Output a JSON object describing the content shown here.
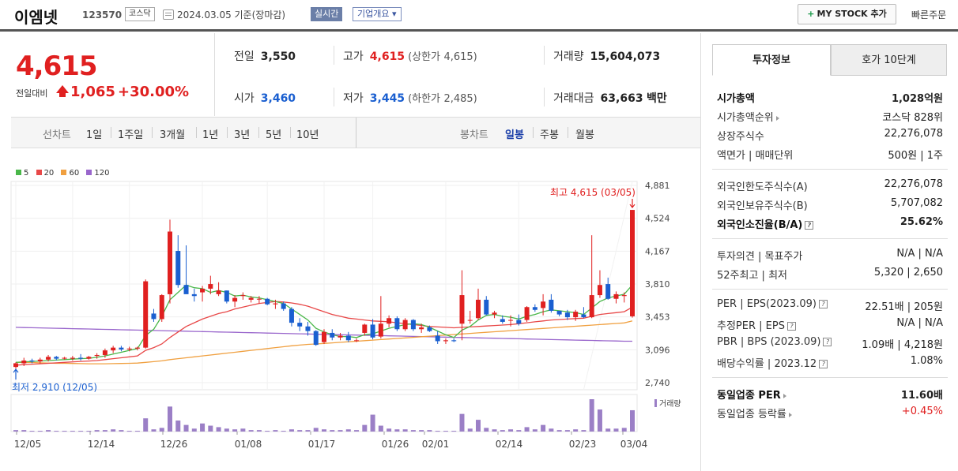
{
  "header": {
    "company": "이엠넷",
    "code": "123570",
    "market": "코스닥",
    "basis": "2024.03.05  기준(장마감)",
    "realtime": "실시간",
    "overview": "기업개요 ▾",
    "mystock": "MY STOCK 추가",
    "quick_order": "빠른주문"
  },
  "price": {
    "current": "4,615",
    "change_label": "전일대비",
    "change": "1,065",
    "change_pct": "+30.00%"
  },
  "stats": {
    "prev_label": "전일",
    "prev": "3,550",
    "high_label": "고가",
    "high": "4,615",
    "upper_label": "(상한가",
    "upper": "4,615)",
    "volume_label": "거래량",
    "volume": "15,604,073",
    "open_label": "시가",
    "open": "3,460",
    "low_label": "저가",
    "low": "3,445",
    "lower_label": "(하한가",
    "lower": "2,485)",
    "amount_label": "거래대금",
    "amount": "63,663",
    "amount_unit": "백만"
  },
  "tabs": {
    "line_label": "선차트",
    "line": [
      "1일",
      "1주일",
      "3개월",
      "1년",
      "3년",
      "5년",
      "10년"
    ],
    "candle_label": "봉차트",
    "candle": [
      "일봉",
      "주봉",
      "월봉"
    ]
  },
  "colors": {
    "up": "#e02020",
    "down": "#1a5fd0",
    "ma5": "#49b749",
    "ma20": "#e84848",
    "ma60": "#f0a040",
    "ma120": "#9966cc",
    "volume": "#9b7fc6"
  },
  "chart_data": {
    "type": "candlestick",
    "legend": [
      "5",
      "20",
      "60",
      "120"
    ],
    "ylim": [
      2740,
      4881
    ],
    "yticks": [
      "4,881",
      "4,524",
      "4,167",
      "3,810",
      "3,453",
      "3,096",
      "2,740"
    ],
    "xticks": [
      "12/05",
      "12/14",
      "12/26",
      "01/08",
      "01/17",
      "01/26",
      "02/01",
      "02/14",
      "02/23",
      "03/04"
    ],
    "high_annotation": "최고 4,615 (03/05)",
    "low_annotation": "최저 2,910 (12/05)",
    "volume_label": "거래량",
    "candles": [
      [
        2910,
        2960,
        2890,
        2950
      ],
      [
        2950,
        3010,
        2920,
        2980
      ],
      [
        2980,
        3000,
        2950,
        2970
      ],
      [
        2970,
        3010,
        2950,
        2990
      ],
      [
        2990,
        3040,
        2970,
        3020
      ],
      [
        3020,
        3030,
        2980,
        3000
      ],
      [
        3000,
        3020,
        2990,
        3010
      ],
      [
        3000,
        3030,
        2980,
        3010
      ],
      [
        3010,
        3050,
        2980,
        3000
      ],
      [
        3000,
        3030,
        2990,
        3020
      ],
      [
        3030,
        3060,
        3000,
        3040
      ],
      [
        3040,
        3110,
        3010,
        3090
      ],
      [
        3090,
        3140,
        3060,
        3120
      ],
      [
        3120,
        3140,
        3080,
        3100
      ],
      [
        3100,
        3130,
        3080,
        3110
      ],
      [
        3110,
        3130,
        3090,
        3120
      ],
      [
        3120,
        3860,
        3110,
        3840
      ],
      [
        3490,
        3540,
        3400,
        3430
      ],
      [
        3430,
        3700,
        3400,
        3690
      ],
      [
        3700,
        4510,
        3600,
        4380
      ],
      [
        4170,
        4340,
        3770,
        3800
      ],
      [
        3800,
        4230,
        3760,
        3700
      ],
      [
        3700,
        3760,
        3620,
        3680
      ],
      [
        3720,
        3790,
        3620,
        3760
      ],
      [
        3760,
        3900,
        3700,
        3810
      ],
      [
        3700,
        3830,
        3680,
        3740
      ],
      [
        3740,
        3740,
        3600,
        3620
      ],
      [
        3620,
        3690,
        3560,
        3660
      ],
      [
        3680,
        3720,
        3640,
        3690
      ],
      [
        3640,
        3680,
        3610,
        3660
      ],
      [
        3650,
        3680,
        3600,
        3650
      ],
      [
        3650,
        3660,
        3580,
        3590
      ],
      [
        3590,
        3640,
        3540,
        3600
      ],
      [
        3600,
        3620,
        3520,
        3540
      ],
      [
        3540,
        3560,
        3350,
        3390
      ],
      [
        3390,
        3440,
        3300,
        3350
      ],
      [
        3350,
        3400,
        3250,
        3300
      ],
      [
        3300,
        3310,
        3140,
        3150
      ],
      [
        3180,
        3320,
        3160,
        3290
      ],
      [
        3280,
        3320,
        3200,
        3230
      ],
      [
        3230,
        3280,
        3200,
        3250
      ],
      [
        3250,
        3290,
        3180,
        3200
      ],
      [
        3200,
        3220,
        3180,
        3200
      ],
      [
        3280,
        3380,
        3250,
        3370
      ],
      [
        3370,
        3430,
        3210,
        3230
      ],
      [
        3240,
        3680,
        3220,
        3380
      ],
      [
        3380,
        3470,
        3340,
        3440
      ],
      [
        3440,
        3460,
        3300,
        3320
      ],
      [
        3320,
        3440,
        3300,
        3420
      ],
      [
        3420,
        3430,
        3300,
        3320
      ],
      [
        3320,
        3380,
        3280,
        3340
      ],
      [
        3340,
        3360,
        3290,
        3300
      ],
      [
        3250,
        3300,
        3160,
        3190
      ],
      [
        3190,
        3220,
        3160,
        3200
      ],
      [
        3200,
        3220,
        3180,
        3190
      ],
      [
        3380,
        3960,
        3200,
        3690
      ],
      [
        3420,
        3520,
        3380,
        3420
      ],
      [
        3440,
        3760,
        3420,
        3640
      ],
      [
        3640,
        3680,
        3470,
        3480
      ],
      [
        3480,
        3520,
        3440,
        3500
      ],
      [
        3430,
        3470,
        3380,
        3400
      ],
      [
        3420,
        3470,
        3350,
        3420
      ],
      [
        3420,
        3480,
        3360,
        3380
      ],
      [
        3420,
        3570,
        3400,
        3560
      ],
      [
        3560,
        3590,
        3510,
        3530
      ],
      [
        3550,
        3700,
        3470,
        3620
      ],
      [
        3640,
        3700,
        3500,
        3520
      ],
      [
        3520,
        3520,
        3460,
        3480
      ],
      [
        3500,
        3530,
        3420,
        3450
      ],
      [
        3450,
        3530,
        3410,
        3510
      ],
      [
        3480,
        3560,
        3440,
        3450
      ],
      [
        3450,
        4340,
        3440,
        3690
      ],
      [
        3690,
        3960,
        3660,
        3800
      ],
      [
        3810,
        3880,
        3640,
        3650
      ],
      [
        3650,
        3730,
        3600,
        3700
      ],
      [
        3680,
        3720,
        3610,
        3690
      ],
      [
        3460,
        4615,
        3445,
        4615
      ]
    ],
    "volume": [
      2,
      2,
      1,
      1,
      2,
      1,
      1,
      1,
      1,
      1,
      2,
      2,
      3,
      2,
      1,
      1,
      18,
      3,
      5,
      34,
      15,
      9,
      4,
      11,
      8,
      6,
      4,
      3,
      4,
      2,
      2,
      1,
      2,
      1,
      3,
      2,
      2,
      5,
      3,
      2,
      2,
      3,
      2,
      9,
      23,
      8,
      4,
      3,
      3,
      2,
      2,
      2,
      1,
      1,
      1,
      24,
      4,
      16,
      5,
      3,
      2,
      3,
      2,
      6,
      3,
      9,
      4,
      2,
      2,
      3,
      2,
      44,
      30,
      4,
      4,
      5,
      29
    ],
    "ma5": [
      2960,
      2965,
      2970,
      2975,
      2980,
      2985,
      2990,
      2995,
      3000,
      3005,
      3015,
      3030,
      3050,
      3070,
      3090,
      3110,
      3250,
      3320,
      3460,
      3640,
      3720,
      3800,
      3770,
      3760,
      3720,
      3740,
      3720,
      3680,
      3690,
      3670,
      3660,
      3640,
      3620,
      3600,
      3540,
      3480,
      3420,
      3330,
      3290,
      3260,
      3240,
      3240,
      3230,
      3260,
      3270,
      3300,
      3330,
      3350,
      3370,
      3380,
      3370,
      3340,
      3300,
      3260,
      3230,
      3310,
      3350,
      3420,
      3470,
      3480,
      3460,
      3450,
      3430,
      3460,
      3480,
      3510,
      3530,
      3520,
      3510,
      3500,
      3480,
      3550,
      3620,
      3660,
      3680,
      3700,
      3800
    ],
    "ma20": [
      2930,
      2935,
      2940,
      2945,
      2950,
      2955,
      2960,
      2965,
      2970,
      2975,
      2980,
      2990,
      3000,
      3010,
      3020,
      3030,
      3090,
      3120,
      3160,
      3230,
      3290,
      3350,
      3390,
      3430,
      3460,
      3490,
      3510,
      3540,
      3560,
      3580,
      3600,
      3610,
      3620,
      3615,
      3605,
      3590,
      3570,
      3540,
      3510,
      3480,
      3460,
      3440,
      3430,
      3420,
      3410,
      3405,
      3400,
      3390,
      3380,
      3370,
      3360,
      3350,
      3345,
      3340,
      3335,
      3340,
      3345,
      3350,
      3355,
      3360,
      3365,
      3370,
      3380,
      3390,
      3400,
      3410,
      3420,
      3425,
      3430,
      3435,
      3440,
      3460,
      3480,
      3490,
      3500,
      3510,
      3560
    ],
    "ma60": [
      2960,
      2960,
      2958,
      2955,
      2952,
      2950,
      2950,
      2948,
      2946,
      2945,
      2945,
      2945,
      2946,
      2948,
      2950,
      2952,
      2960,
      2968,
      2976,
      2990,
      3000,
      3010,
      3020,
      3030,
      3040,
      3050,
      3060,
      3070,
      3080,
      3090,
      3100,
      3110,
      3120,
      3130,
      3140,
      3148,
      3155,
      3160,
      3166,
      3172,
      3178,
      3184,
      3190,
      3196,
      3202,
      3208,
      3214,
      3220,
      3226,
      3232,
      3238,
      3244,
      3250,
      3256,
      3262,
      3268,
      3274,
      3280,
      3286,
      3292,
      3298,
      3304,
      3310,
      3316,
      3322,
      3328,
      3334,
      3340,
      3346,
      3352,
      3358,
      3364,
      3370,
      3376,
      3382,
      3388,
      3410
    ],
    "ma120": [
      3340,
      3338,
      3336,
      3334,
      3332,
      3330,
      3328,
      3326,
      3324,
      3322,
      3320,
      3318,
      3316,
      3314,
      3312,
      3310,
      3308,
      3306,
      3304,
      3302,
      3300,
      3298,
      3296,
      3294,
      3292,
      3290,
      3288,
      3286,
      3284,
      3282,
      3280,
      3278,
      3276,
      3274,
      3272,
      3270,
      3268,
      3266,
      3264,
      3262,
      3260,
      3258,
      3256,
      3254,
      3252,
      3250,
      3248,
      3246,
      3244,
      3242,
      3240,
      3238,
      3236,
      3234,
      3232,
      3230,
      3228,
      3226,
      3224,
      3222,
      3220,
      3218,
      3216,
      3214,
      3212,
      3210,
      3208,
      3206,
      3204,
      3202,
      3200,
      3198,
      3196,
      3194,
      3192,
      3190,
      3190
    ]
  },
  "side": {
    "tab_on": "투자정보",
    "tab_off": "호가 10단계",
    "rows1": [
      {
        "k": "시가총액",
        "v": "1,028억원",
        "bold": true
      },
      {
        "k": "시가총액순위",
        "v": "코스닥 828위",
        "arrow": true
      },
      {
        "k": "상장주식수",
        "v": "22,276,078"
      },
      {
        "k": "액면가 | 매매단위",
        "v": "500원 | 1주"
      }
    ],
    "rows2": [
      {
        "k": "외국인한도주식수(A)",
        "v": "22,276,078"
      },
      {
        "k": "외국인보유주식수(B)",
        "v": "5,707,082"
      },
      {
        "k": "외국인소진율(B/A)",
        "v": "25.62%",
        "bold": true,
        "q": true
      }
    ],
    "rows3": [
      {
        "k": "투자의견 | 목표주가",
        "v": "N/A | N/A"
      },
      {
        "k": "52주최고 | 최저",
        "v": "5,320 | 2,650"
      }
    ],
    "rows4": [
      {
        "k": "PER | EPS(2023.09)",
        "v": "22.51배 | 205원",
        "q": true
      },
      {
        "k": "추정PER | EPS",
        "v": "N/A | N/A",
        "q": true
      },
      {
        "k": "PBR | BPS (2023.09)",
        "v": "1.09배 | 4,218원",
        "q": true
      },
      {
        "k": "배당수익률 | 2023.12",
        "v": "1.08%",
        "q": true
      }
    ],
    "rows5": [
      {
        "k": "동일업종 PER",
        "v": "11.60배",
        "bold": true,
        "arrow": true
      },
      {
        "k": "동일업종 등락률",
        "v": "+0.45%",
        "arrow": true,
        "red": true
      }
    ],
    "question_mark": "?"
  }
}
